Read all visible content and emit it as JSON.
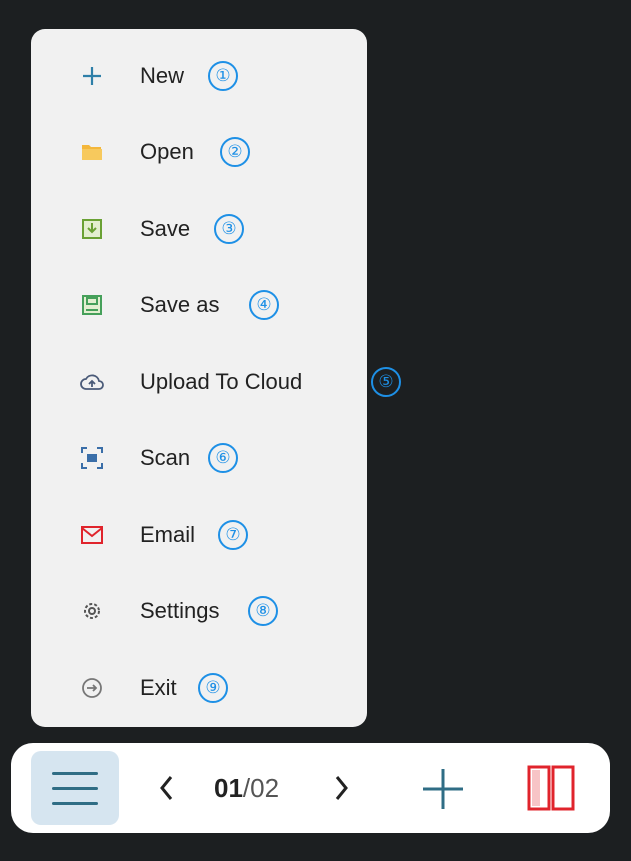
{
  "menu": {
    "items": [
      {
        "label": "New",
        "icon": "plus-icon",
        "badge": "①"
      },
      {
        "label": "Open",
        "icon": "folder-icon",
        "badge": "②"
      },
      {
        "label": "Save",
        "icon": "save-icon",
        "badge": "③"
      },
      {
        "label": "Save as",
        "icon": "save-as-icon",
        "badge": "④"
      },
      {
        "label": "Upload To Cloud",
        "icon": "cloud-upload-icon",
        "badge": "⑤"
      },
      {
        "label": "Scan",
        "icon": "scan-icon",
        "badge": "⑥"
      },
      {
        "label": "Email",
        "icon": "email-icon",
        "badge": "⑦"
      },
      {
        "label": "Settings",
        "icon": "gear-icon",
        "badge": "⑧"
      },
      {
        "label": "Exit",
        "icon": "exit-icon",
        "badge": "⑨"
      }
    ]
  },
  "toolbar": {
    "page_current": "01",
    "page_separator": "/",
    "page_total": "02"
  },
  "colors": {
    "badge": "#1e90e6",
    "menu_bg": "#f1f1f1",
    "accent_blue": "#2f6d85",
    "accent_red": "#e0242c"
  }
}
